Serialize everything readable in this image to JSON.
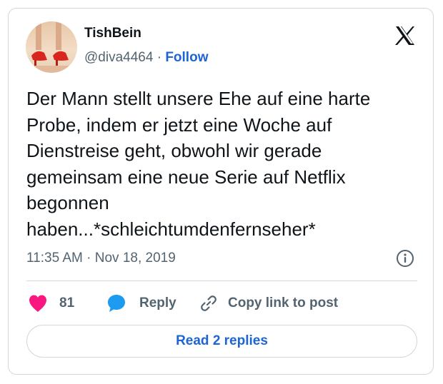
{
  "author": {
    "name": "TishBein",
    "handle": "@diva4464",
    "separator": " · ",
    "follow_label": "Follow"
  },
  "tweet": {
    "text": "Der Mann stellt unsere Ehe auf eine harte\nProbe, indem er jetzt eine Woche auf\nDienstreise geht, obwohl wir gerade\ngemeinsam eine neue Serie auf Netflix\nbegonnen\nhaben...*schleichtumdenfernseher*",
    "timestamp": "11:35 AM · Nov 18, 2019"
  },
  "actions": {
    "like_count": "81",
    "reply_label": "Reply",
    "copy_label": "Copy link to post"
  },
  "footer": {
    "read_replies_label": "Read 2 replies"
  },
  "icons": {
    "logo": "x-logo-icon",
    "info": "info-icon",
    "like": "heart-icon",
    "reply": "speech-bubble-icon",
    "copy": "link-icon"
  },
  "colors": {
    "link_blue": "#1d64d4",
    "heart_pink": "#f91880",
    "reply_blue": "#1d9bf0",
    "text": "#0f1419",
    "muted": "#536471",
    "border": "#cfd9de"
  }
}
